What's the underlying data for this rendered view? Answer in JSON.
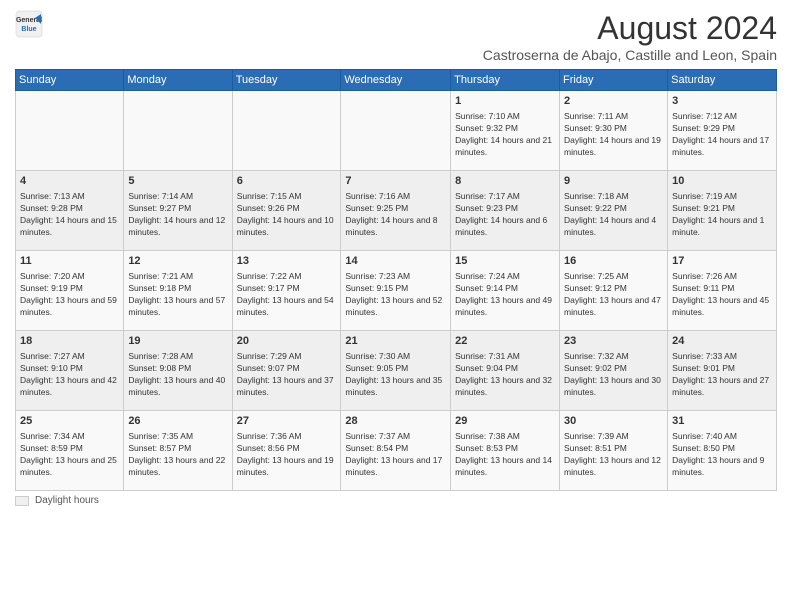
{
  "logo": {
    "general": "General",
    "blue": "Blue"
  },
  "title": "August 2024",
  "subtitle": "Castroserna de Abajo, Castille and Leon, Spain",
  "headers": [
    "Sunday",
    "Monday",
    "Tuesday",
    "Wednesday",
    "Thursday",
    "Friday",
    "Saturday"
  ],
  "weeks": [
    [
      {
        "day": "",
        "sunrise": "",
        "sunset": "",
        "daylight": ""
      },
      {
        "day": "",
        "sunrise": "",
        "sunset": "",
        "daylight": ""
      },
      {
        "day": "",
        "sunrise": "",
        "sunset": "",
        "daylight": ""
      },
      {
        "day": "",
        "sunrise": "",
        "sunset": "",
        "daylight": ""
      },
      {
        "day": "1",
        "sunrise": "Sunrise: 7:10 AM",
        "sunset": "Sunset: 9:32 PM",
        "daylight": "Daylight: 14 hours and 21 minutes."
      },
      {
        "day": "2",
        "sunrise": "Sunrise: 7:11 AM",
        "sunset": "Sunset: 9:30 PM",
        "daylight": "Daylight: 14 hours and 19 minutes."
      },
      {
        "day": "3",
        "sunrise": "Sunrise: 7:12 AM",
        "sunset": "Sunset: 9:29 PM",
        "daylight": "Daylight: 14 hours and 17 minutes."
      }
    ],
    [
      {
        "day": "4",
        "sunrise": "Sunrise: 7:13 AM",
        "sunset": "Sunset: 9:28 PM",
        "daylight": "Daylight: 14 hours and 15 minutes."
      },
      {
        "day": "5",
        "sunrise": "Sunrise: 7:14 AM",
        "sunset": "Sunset: 9:27 PM",
        "daylight": "Daylight: 14 hours and 12 minutes."
      },
      {
        "day": "6",
        "sunrise": "Sunrise: 7:15 AM",
        "sunset": "Sunset: 9:26 PM",
        "daylight": "Daylight: 14 hours and 10 minutes."
      },
      {
        "day": "7",
        "sunrise": "Sunrise: 7:16 AM",
        "sunset": "Sunset: 9:25 PM",
        "daylight": "Daylight: 14 hours and 8 minutes."
      },
      {
        "day": "8",
        "sunrise": "Sunrise: 7:17 AM",
        "sunset": "Sunset: 9:23 PM",
        "daylight": "Daylight: 14 hours and 6 minutes."
      },
      {
        "day": "9",
        "sunrise": "Sunrise: 7:18 AM",
        "sunset": "Sunset: 9:22 PM",
        "daylight": "Daylight: 14 hours and 4 minutes."
      },
      {
        "day": "10",
        "sunrise": "Sunrise: 7:19 AM",
        "sunset": "Sunset: 9:21 PM",
        "daylight": "Daylight: 14 hours and 1 minute."
      }
    ],
    [
      {
        "day": "11",
        "sunrise": "Sunrise: 7:20 AM",
        "sunset": "Sunset: 9:19 PM",
        "daylight": "Daylight: 13 hours and 59 minutes."
      },
      {
        "day": "12",
        "sunrise": "Sunrise: 7:21 AM",
        "sunset": "Sunset: 9:18 PM",
        "daylight": "Daylight: 13 hours and 57 minutes."
      },
      {
        "day": "13",
        "sunrise": "Sunrise: 7:22 AM",
        "sunset": "Sunset: 9:17 PM",
        "daylight": "Daylight: 13 hours and 54 minutes."
      },
      {
        "day": "14",
        "sunrise": "Sunrise: 7:23 AM",
        "sunset": "Sunset: 9:15 PM",
        "daylight": "Daylight: 13 hours and 52 minutes."
      },
      {
        "day": "15",
        "sunrise": "Sunrise: 7:24 AM",
        "sunset": "Sunset: 9:14 PM",
        "daylight": "Daylight: 13 hours and 49 minutes."
      },
      {
        "day": "16",
        "sunrise": "Sunrise: 7:25 AM",
        "sunset": "Sunset: 9:12 PM",
        "daylight": "Daylight: 13 hours and 47 minutes."
      },
      {
        "day": "17",
        "sunrise": "Sunrise: 7:26 AM",
        "sunset": "Sunset: 9:11 PM",
        "daylight": "Daylight: 13 hours and 45 minutes."
      }
    ],
    [
      {
        "day": "18",
        "sunrise": "Sunrise: 7:27 AM",
        "sunset": "Sunset: 9:10 PM",
        "daylight": "Daylight: 13 hours and 42 minutes."
      },
      {
        "day": "19",
        "sunrise": "Sunrise: 7:28 AM",
        "sunset": "Sunset: 9:08 PM",
        "daylight": "Daylight: 13 hours and 40 minutes."
      },
      {
        "day": "20",
        "sunrise": "Sunrise: 7:29 AM",
        "sunset": "Sunset: 9:07 PM",
        "daylight": "Daylight: 13 hours and 37 minutes."
      },
      {
        "day": "21",
        "sunrise": "Sunrise: 7:30 AM",
        "sunset": "Sunset: 9:05 PM",
        "daylight": "Daylight: 13 hours and 35 minutes."
      },
      {
        "day": "22",
        "sunrise": "Sunrise: 7:31 AM",
        "sunset": "Sunset: 9:04 PM",
        "daylight": "Daylight: 13 hours and 32 minutes."
      },
      {
        "day": "23",
        "sunrise": "Sunrise: 7:32 AM",
        "sunset": "Sunset: 9:02 PM",
        "daylight": "Daylight: 13 hours and 30 minutes."
      },
      {
        "day": "24",
        "sunrise": "Sunrise: 7:33 AM",
        "sunset": "Sunset: 9:01 PM",
        "daylight": "Daylight: 13 hours and 27 minutes."
      }
    ],
    [
      {
        "day": "25",
        "sunrise": "Sunrise: 7:34 AM",
        "sunset": "Sunset: 8:59 PM",
        "daylight": "Daylight: 13 hours and 25 minutes."
      },
      {
        "day": "26",
        "sunrise": "Sunrise: 7:35 AM",
        "sunset": "Sunset: 8:57 PM",
        "daylight": "Daylight: 13 hours and 22 minutes."
      },
      {
        "day": "27",
        "sunrise": "Sunrise: 7:36 AM",
        "sunset": "Sunset: 8:56 PM",
        "daylight": "Daylight: 13 hours and 19 minutes."
      },
      {
        "day": "28",
        "sunrise": "Sunrise: 7:37 AM",
        "sunset": "Sunset: 8:54 PM",
        "daylight": "Daylight: 13 hours and 17 minutes."
      },
      {
        "day": "29",
        "sunrise": "Sunrise: 7:38 AM",
        "sunset": "Sunset: 8:53 PM",
        "daylight": "Daylight: 13 hours and 14 minutes."
      },
      {
        "day": "30",
        "sunrise": "Sunrise: 7:39 AM",
        "sunset": "Sunset: 8:51 PM",
        "daylight": "Daylight: 13 hours and 12 minutes."
      },
      {
        "day": "31",
        "sunrise": "Sunrise: 7:40 AM",
        "sunset": "Sunset: 8:50 PM",
        "daylight": "Daylight: 13 hours and 9 minutes."
      }
    ]
  ],
  "legend": {
    "label": "Daylight hours"
  }
}
